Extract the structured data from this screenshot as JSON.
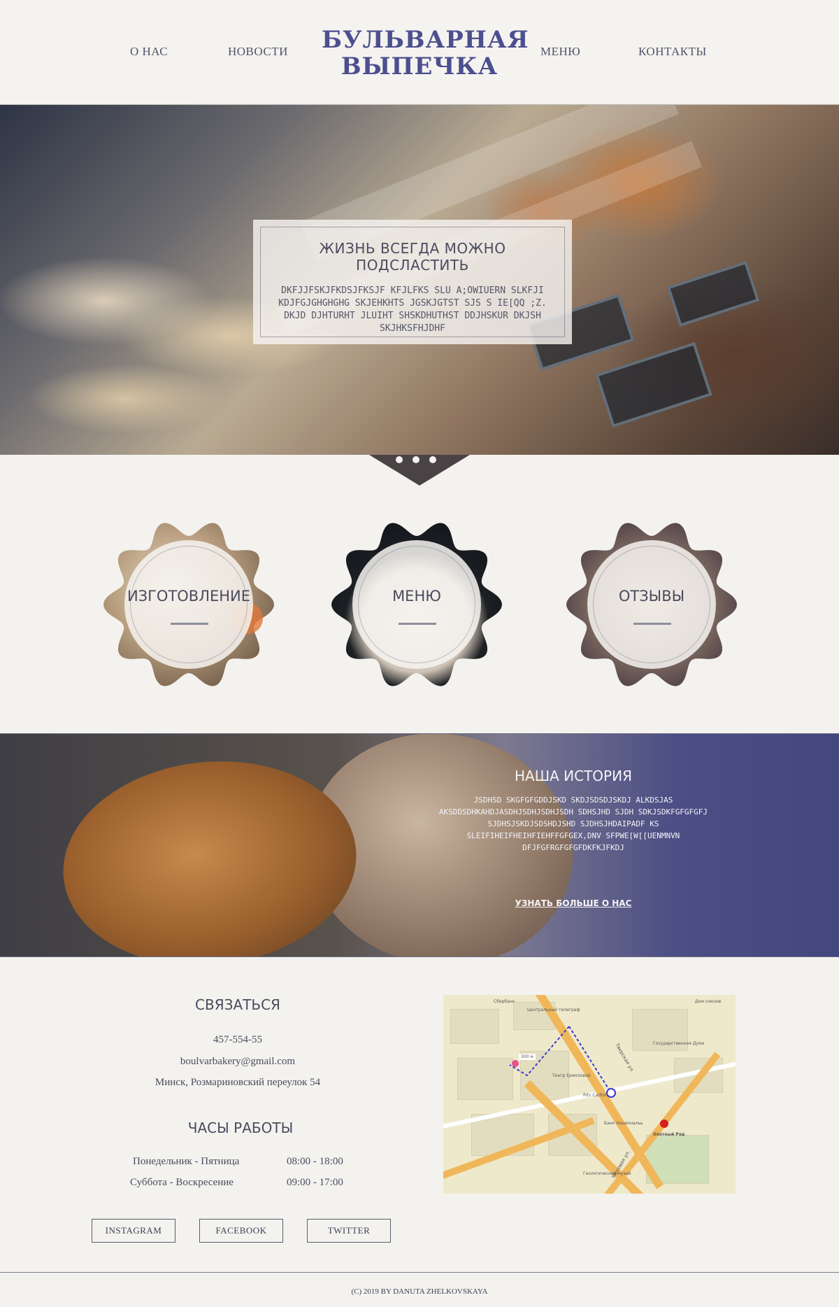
{
  "header": {
    "nav": [
      "О НАС",
      "НОВОСТИ",
      "МЕНЮ",
      "КОНТАКТЫ"
    ],
    "logo_line1": "БУЛЬВАРНАЯ",
    "logo_line2": "ВЫПЕЧКА"
  },
  "hero": {
    "title": "ЖИЗНЬ ВСЕГДА МОЖНО ПОДСЛАСТИТЬ",
    "text": "DKFJJFSKJFKDSJFKSJF KFJLFKS SLU A;OWIUERN SLKFJI KDJFGJGHGHGHG SKJEHKHTS  JGSKJGTST SJS S IE[QQ ;Z. DKJD DJHTURHT JLUIHT SHSKDHUTHST DDJHSKUR DKJSH SKJHKSFHJDHF"
  },
  "badges": [
    "ИЗГОТОВЛЕНИЕ",
    "МЕНЮ",
    "ОТЗЫВЫ"
  ],
  "history": {
    "title": "НАША ИСТОРИЯ",
    "text": "JSDHSD SKGFGFGDDJSKD SKDJSDSDJSKDJ ALKDSJAS AKSDDSDHKAHDJASDHJSDHJSDHJSDH SDHSJHD SJDH SDKJSDKFGFGFGFJ SJDHSJSKDJSDSHDJSHD SJDHSJHDAIPADF KS SLEIFIHEIFHEIHFIEHFFGFGEX,DNV SFPWE[W[[UENMNVN DFJFGFRGFGFGFDKFKJFKDJ",
    "link": "УЗНАТЬ БОЛЬШЕ О НАС"
  },
  "contact": {
    "title": "СВЯЗАТЬСЯ",
    "phone": "457-554-55",
    "email": "boulvarbakery@gmail.com",
    "address": "Минск, Розмариновский переулок 54"
  },
  "hours": {
    "title": "ЧАСЫ РАБОТЫ",
    "rows": [
      {
        "days": "Понедельник - Пятница",
        "time": "08:00 - 18:00"
      },
      {
        "days": "Суббота - Воскресение",
        "time": "09:00 - 17:00"
      }
    ]
  },
  "map": {
    "labels": [
      "Сбербанк",
      "Центральный телеграф",
      "Театр Ермоловой",
      "Государственная Дума",
      "Ritz Carlton",
      "Охотный Ряд",
      "Тверская ул.",
      "Моховая ул.",
      "300 м",
      "Дом союзов",
      "Геологический музей",
      "Банк Национальь"
    ]
  },
  "social": [
    "INSTAGRAM",
    "FACEBOOK",
    "TWITTER"
  ],
  "footer": {
    "text": "(C) 2019  BY DANUTA ZHELKOVSKAYA"
  },
  "colors": {
    "background": "#f3f2ee",
    "logo": "#4c4f8f",
    "text": "#4a4c5e",
    "history_accent": "#43477e"
  }
}
